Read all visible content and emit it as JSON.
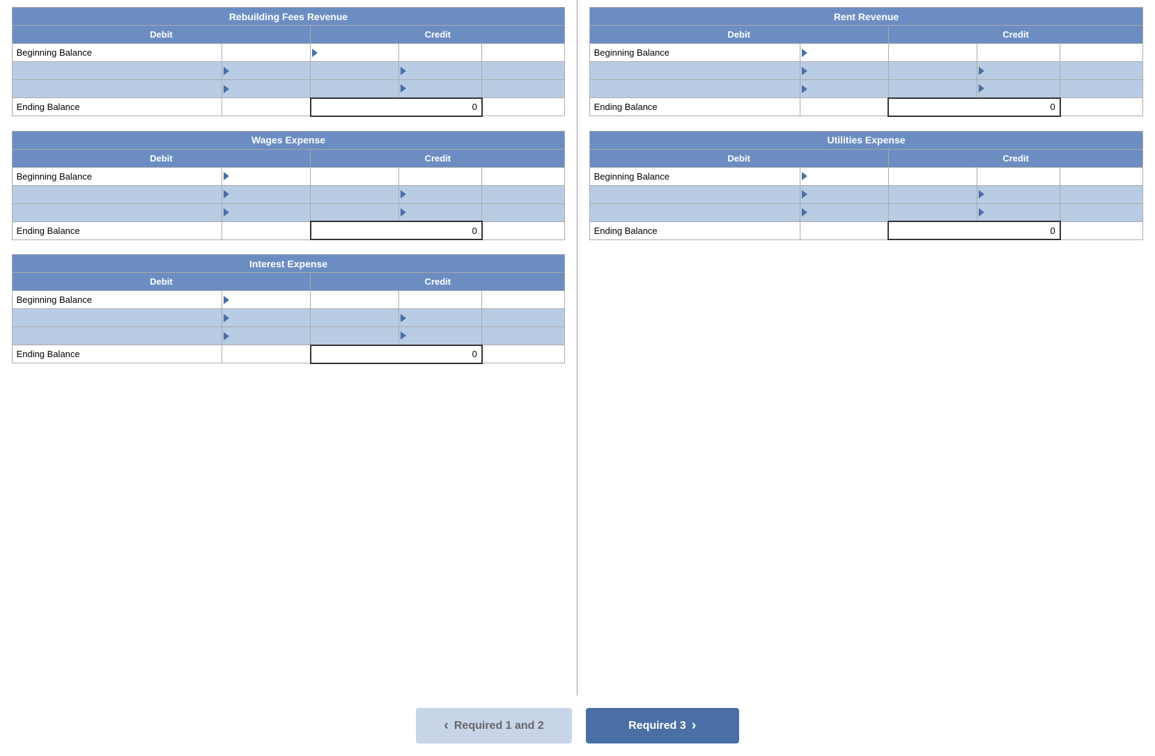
{
  "tables": {
    "left": [
      {
        "id": "rebuilding-fees-revenue",
        "title": "Rebuilding Fees Revenue",
        "debit_label": "Debit",
        "credit_label": "Credit",
        "beginning_balance_label": "Beginning Balance",
        "ending_balance_label": "Ending Balance",
        "ending_value": "0"
      },
      {
        "id": "wages-expense",
        "title": "Wages Expense",
        "debit_label": "Debit",
        "credit_label": "Credit",
        "beginning_balance_label": "Beginning Balance",
        "ending_balance_label": "Ending Balance",
        "ending_value": "0"
      },
      {
        "id": "interest-expense",
        "title": "Interest Expense",
        "debit_label": "Debit",
        "credit_label": "Credit",
        "beginning_balance_label": "Beginning Balance",
        "ending_balance_label": "Ending Balance",
        "ending_value": "0"
      }
    ],
    "right": [
      {
        "id": "rent-revenue",
        "title": "Rent Revenue",
        "debit_label": "Debit",
        "credit_label": "Credit",
        "beginning_balance_label": "Beginning Balance",
        "ending_balance_label": "Ending Balance",
        "ending_value": "0"
      },
      {
        "id": "utilities-expense",
        "title": "Utilities Expense",
        "debit_label": "Debit",
        "credit_label": "Credit",
        "beginning_balance_label": "Beginning Balance",
        "ending_balance_label": "Ending Balance",
        "ending_value": "0"
      }
    ]
  },
  "navigation": {
    "prev_label": "Required 1 and 2",
    "next_label": "Required 3",
    "prev_arrow": "‹",
    "next_arrow": "›"
  }
}
